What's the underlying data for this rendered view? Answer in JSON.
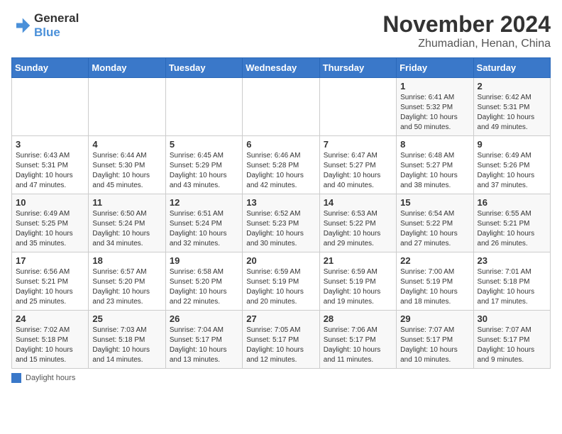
{
  "logo": {
    "line1": "General",
    "line2": "Blue"
  },
  "title": "November 2024",
  "location": "Zhumadian, Henan, China",
  "days_of_week": [
    "Sunday",
    "Monday",
    "Tuesday",
    "Wednesday",
    "Thursday",
    "Friday",
    "Saturday"
  ],
  "legend_text": "Daylight hours",
  "weeks": [
    [
      {
        "day": "",
        "info": ""
      },
      {
        "day": "",
        "info": ""
      },
      {
        "day": "",
        "info": ""
      },
      {
        "day": "",
        "info": ""
      },
      {
        "day": "",
        "info": ""
      },
      {
        "day": "1",
        "info": "Sunrise: 6:41 AM\nSunset: 5:32 PM\nDaylight: 10 hours\nand 50 minutes."
      },
      {
        "day": "2",
        "info": "Sunrise: 6:42 AM\nSunset: 5:31 PM\nDaylight: 10 hours\nand 49 minutes."
      }
    ],
    [
      {
        "day": "3",
        "info": "Sunrise: 6:43 AM\nSunset: 5:31 PM\nDaylight: 10 hours\nand 47 minutes."
      },
      {
        "day": "4",
        "info": "Sunrise: 6:44 AM\nSunset: 5:30 PM\nDaylight: 10 hours\nand 45 minutes."
      },
      {
        "day": "5",
        "info": "Sunrise: 6:45 AM\nSunset: 5:29 PM\nDaylight: 10 hours\nand 43 minutes."
      },
      {
        "day": "6",
        "info": "Sunrise: 6:46 AM\nSunset: 5:28 PM\nDaylight: 10 hours\nand 42 minutes."
      },
      {
        "day": "7",
        "info": "Sunrise: 6:47 AM\nSunset: 5:27 PM\nDaylight: 10 hours\nand 40 minutes."
      },
      {
        "day": "8",
        "info": "Sunrise: 6:48 AM\nSunset: 5:27 PM\nDaylight: 10 hours\nand 38 minutes."
      },
      {
        "day": "9",
        "info": "Sunrise: 6:49 AM\nSunset: 5:26 PM\nDaylight: 10 hours\nand 37 minutes."
      }
    ],
    [
      {
        "day": "10",
        "info": "Sunrise: 6:49 AM\nSunset: 5:25 PM\nDaylight: 10 hours\nand 35 minutes."
      },
      {
        "day": "11",
        "info": "Sunrise: 6:50 AM\nSunset: 5:24 PM\nDaylight: 10 hours\nand 34 minutes."
      },
      {
        "day": "12",
        "info": "Sunrise: 6:51 AM\nSunset: 5:24 PM\nDaylight: 10 hours\nand 32 minutes."
      },
      {
        "day": "13",
        "info": "Sunrise: 6:52 AM\nSunset: 5:23 PM\nDaylight: 10 hours\nand 30 minutes."
      },
      {
        "day": "14",
        "info": "Sunrise: 6:53 AM\nSunset: 5:22 PM\nDaylight: 10 hours\nand 29 minutes."
      },
      {
        "day": "15",
        "info": "Sunrise: 6:54 AM\nSunset: 5:22 PM\nDaylight: 10 hours\nand 27 minutes."
      },
      {
        "day": "16",
        "info": "Sunrise: 6:55 AM\nSunset: 5:21 PM\nDaylight: 10 hours\nand 26 minutes."
      }
    ],
    [
      {
        "day": "17",
        "info": "Sunrise: 6:56 AM\nSunset: 5:21 PM\nDaylight: 10 hours\nand 25 minutes."
      },
      {
        "day": "18",
        "info": "Sunrise: 6:57 AM\nSunset: 5:20 PM\nDaylight: 10 hours\nand 23 minutes."
      },
      {
        "day": "19",
        "info": "Sunrise: 6:58 AM\nSunset: 5:20 PM\nDaylight: 10 hours\nand 22 minutes."
      },
      {
        "day": "20",
        "info": "Sunrise: 6:59 AM\nSunset: 5:19 PM\nDaylight: 10 hours\nand 20 minutes."
      },
      {
        "day": "21",
        "info": "Sunrise: 6:59 AM\nSunset: 5:19 PM\nDaylight: 10 hours\nand 19 minutes."
      },
      {
        "day": "22",
        "info": "Sunrise: 7:00 AM\nSunset: 5:19 PM\nDaylight: 10 hours\nand 18 minutes."
      },
      {
        "day": "23",
        "info": "Sunrise: 7:01 AM\nSunset: 5:18 PM\nDaylight: 10 hours\nand 17 minutes."
      }
    ],
    [
      {
        "day": "24",
        "info": "Sunrise: 7:02 AM\nSunset: 5:18 PM\nDaylight: 10 hours\nand 15 minutes."
      },
      {
        "day": "25",
        "info": "Sunrise: 7:03 AM\nSunset: 5:18 PM\nDaylight: 10 hours\nand 14 minutes."
      },
      {
        "day": "26",
        "info": "Sunrise: 7:04 AM\nSunset: 5:17 PM\nDaylight: 10 hours\nand 13 minutes."
      },
      {
        "day": "27",
        "info": "Sunrise: 7:05 AM\nSunset: 5:17 PM\nDaylight: 10 hours\nand 12 minutes."
      },
      {
        "day": "28",
        "info": "Sunrise: 7:06 AM\nSunset: 5:17 PM\nDaylight: 10 hours\nand 11 minutes."
      },
      {
        "day": "29",
        "info": "Sunrise: 7:07 AM\nSunset: 5:17 PM\nDaylight: 10 hours\nand 10 minutes."
      },
      {
        "day": "30",
        "info": "Sunrise: 7:07 AM\nSunset: 5:17 PM\nDaylight: 10 hours\nand 9 minutes."
      }
    ]
  ]
}
